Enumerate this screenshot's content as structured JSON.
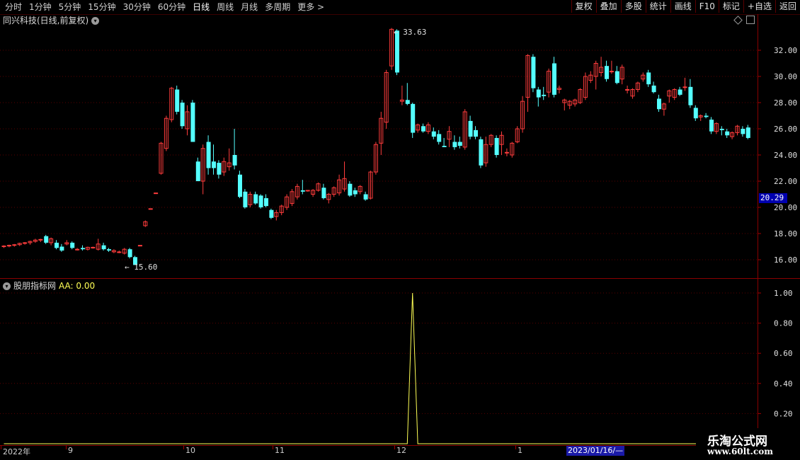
{
  "toolbar": {
    "periods": [
      "分时",
      "1分钟",
      "5分钟",
      "15分钟",
      "30分钟",
      "60分钟",
      "日线",
      "周线",
      "月线",
      "多周期",
      "更多 >"
    ],
    "active_period": "日线",
    "buttons": [
      "复权",
      "叠加",
      "多股",
      "统计",
      "画线",
      "F10",
      "标记",
      "+自选",
      "返回"
    ]
  },
  "main_panel": {
    "title": "同兴科技(日线,前复权)",
    "price_axis_labels": [
      "32.00",
      "30.00",
      "28.00",
      "26.00",
      "24.00",
      "22.00",
      "20.00",
      "18.00",
      "16.00"
    ],
    "current_price_flag": "20.29",
    "high_annotation": "33.63",
    "low_annotation": "15.60"
  },
  "indicator_panel": {
    "name": "股朋指标网",
    "series_label": "AA: 0.00",
    "axis_labels": [
      "1.00",
      "0.80",
      "0.60",
      "0.40",
      "0.20"
    ]
  },
  "date_axis": {
    "labels": [
      "2022年",
      "9",
      "10",
      "11",
      "12",
      "1"
    ],
    "cursor_date": "2023/01/16/—"
  },
  "watermark": {
    "line1": "乐淘公式网",
    "line2": "www.60lt.com"
  },
  "colors": {
    "up_candle": "#ff3c3c",
    "down_candle": "#54ffff",
    "indicator_line": "#ffff55",
    "grid": "#5a0000",
    "flag_bg": "#0000b0"
  },
  "chart_data": {
    "type": "candlestick",
    "y_range": [
      15,
      34
    ],
    "candles": [
      [
        17.0,
        17.05,
        16.95,
        17.1,
        16.9
      ],
      [
        17.05,
        17.1,
        17.0,
        17.15,
        16.95
      ],
      [
        17.1,
        17.15,
        17.05,
        17.2,
        17.0
      ],
      [
        17.15,
        17.25,
        17.1,
        17.3,
        17.05
      ],
      [
        17.25,
        17.3,
        17.2,
        17.35,
        17.15
      ],
      [
        17.3,
        17.4,
        17.2,
        17.45,
        17.15
      ],
      [
        17.4,
        17.5,
        17.35,
        17.6,
        17.3
      ],
      [
        17.5,
        17.55,
        17.4,
        17.6,
        17.35
      ],
      [
        17.8,
        17.3,
        17.9,
        17.9,
        17.2
      ],
      [
        17.3,
        17.6,
        17.2,
        17.7,
        17.1
      ],
      [
        17.3,
        16.9,
        17.4,
        17.5,
        16.8
      ],
      [
        17.0,
        16.7,
        17.1,
        17.2,
        16.6
      ],
      [
        17.2,
        17.3,
        17.4,
        17.5,
        17.1
      ],
      [
        17.3,
        16.9,
        17.4,
        17.4,
        16.8
      ],
      [
        16.8,
        16.8,
        16.9,
        16.9,
        16.7
      ],
      [
        16.9,
        16.8,
        17.0,
        17.1,
        16.7
      ],
      [
        16.8,
        16.95,
        16.75,
        17.0,
        16.7
      ],
      [
        16.9,
        16.95,
        16.85,
        17.0,
        16.85
      ],
      [
        16.8,
        17.2,
        16.7,
        17.6,
        16.7
      ],
      [
        17.1,
        16.8,
        17.2,
        17.3,
        16.7
      ],
      [
        16.8,
        16.7,
        16.85,
        16.9,
        16.6
      ],
      [
        16.6,
        16.7,
        16.55,
        16.8,
        16.5
      ],
      [
        16.6,
        16.6,
        16.55,
        16.7,
        16.5
      ],
      [
        16.5,
        16.8,
        16.45,
        16.9,
        16.4
      ],
      [
        16.8,
        16.2,
        16.85,
        16.9,
        16.1
      ],
      [
        16.2,
        15.6,
        16.3,
        16.3,
        15.6
      ],
      [
        17.1,
        17.1,
        17.1,
        17.1,
        17.1
      ],
      [
        18.6,
        18.9,
        18.5,
        19.0,
        18.5
      ],
      [
        19.9,
        19.9,
        19.9,
        19.9,
        19.9
      ],
      [
        21.1,
        21.1,
        21.1,
        21.1,
        21.1
      ],
      [
        22.6,
        24.9,
        22.5,
        25.0,
        22.5
      ],
      [
        24.5,
        26.8,
        24.4,
        27.0,
        24.3
      ],
      [
        26.7,
        29.1,
        26.6,
        29.2,
        26.5
      ],
      [
        29.0,
        27.3,
        29.2,
        29.3,
        27.1
      ],
      [
        28.0,
        26.2,
        28.1,
        28.2,
        26.0
      ],
      [
        26.0,
        27.3,
        25.5,
        27.8,
        25.5
      ],
      [
        28.0,
        25.0,
        28.2,
        28.2,
        25.0
      ],
      [
        23.5,
        22.0,
        23.6,
        23.8,
        22.0
      ],
      [
        22.0,
        24.5,
        21.8,
        24.8,
        21.0
      ],
      [
        25.0,
        23.0,
        25.2,
        25.5,
        22.5
      ],
      [
        23.5,
        23.0,
        24.8,
        24.8,
        22.5
      ],
      [
        23.4,
        22.5,
        23.5,
        23.6,
        22.2
      ],
      [
        22.7,
        23.5,
        22.6,
        23.8,
        22.4
      ],
      [
        23.1,
        23.4,
        23.0,
        24.5,
        22.8
      ],
      [
        24.0,
        23.2,
        24.1,
        26.0,
        22.9
      ],
      [
        22.5,
        20.8,
        22.6,
        22.8,
        20.7
      ],
      [
        21.2,
        20.0,
        21.3,
        21.4,
        19.9
      ],
      [
        20.2,
        21.0,
        20.1,
        21.2,
        20.0
      ],
      [
        21.0,
        20.3,
        21.1,
        21.2,
        20.2
      ],
      [
        20.9,
        20.0,
        21.0,
        21.0,
        19.9
      ],
      [
        20.7,
        20.1,
        20.9,
        21.0,
        20.0
      ],
      [
        19.8,
        19.2,
        19.9,
        19.9,
        19.1
      ],
      [
        19.3,
        19.6,
        19.0,
        19.8,
        19.0
      ],
      [
        19.6,
        20.1,
        19.5,
        20.2,
        19.4
      ],
      [
        20.0,
        20.8,
        19.9,
        21.0,
        19.8
      ],
      [
        20.3,
        21.2,
        20.2,
        21.4,
        20.1
      ],
      [
        20.8,
        21.6,
        20.7,
        21.8,
        20.6
      ],
      [
        21.3,
        21.2,
        21.4,
        22.1,
        21.0
      ],
      [
        21.3,
        21.3,
        21.3,
        21.3,
        21.2
      ],
      [
        21.0,
        21.3,
        20.9,
        21.4,
        20.8
      ],
      [
        21.3,
        21.8,
        21.2,
        21.9,
        21.2
      ],
      [
        21.5,
        20.7,
        21.6,
        21.8,
        20.6
      ],
      [
        20.6,
        21.0,
        20.5,
        21.1,
        20.3
      ],
      [
        21.0,
        21.5,
        20.9,
        21.6,
        20.8
      ],
      [
        21.1,
        22.1,
        21.0,
        22.5,
        20.9
      ],
      [
        21.4,
        22.2,
        21.3,
        23.5,
        21.2
      ],
      [
        21.8,
        20.9,
        21.9,
        22.0,
        20.8
      ],
      [
        21.3,
        21.0,
        21.4,
        21.5,
        20.8
      ],
      [
        21.2,
        21.6,
        21.1,
        21.7,
        21.0
      ],
      [
        21.0,
        20.6,
        21.1,
        21.2,
        20.5
      ],
      [
        20.7,
        22.7,
        20.6,
        22.8,
        20.6
      ],
      [
        22.7,
        24.8,
        22.6,
        25.0,
        22.5
      ],
      [
        24.9,
        26.8,
        24.8,
        27.3,
        24.0
      ],
      [
        26.5,
        30.3,
        26.4,
        30.5,
        26.0
      ],
      [
        30.8,
        33.6,
        30.5,
        33.7,
        30.5
      ],
      [
        33.5,
        30.3,
        33.6,
        33.6,
        30.1
      ],
      [
        28.1,
        28.2,
        28.0,
        29.3,
        27.8
      ],
      [
        28.2,
        27.9,
        28.3,
        29.5,
        27.8
      ],
      [
        27.9,
        25.7,
        28.0,
        28.0,
        25.3
      ],
      [
        25.9,
        26.3,
        25.8,
        26.4,
        25.7
      ],
      [
        26.2,
        25.8,
        26.3,
        26.4,
        25.7
      ],
      [
        25.8,
        26.3,
        25.6,
        26.5,
        25.6
      ],
      [
        25.8,
        25.4,
        26.0,
        26.1,
        25.2
      ],
      [
        25.6,
        25.0,
        25.8,
        25.9,
        24.8
      ],
      [
        24.7,
        24.6,
        24.8,
        25.3,
        24.6
      ],
      [
        25.2,
        25.8,
        24.8,
        26.2,
        24.6
      ],
      [
        25.0,
        24.6,
        25.4,
        25.5,
        24.4
      ],
      [
        25.0,
        24.7,
        25.2,
        25.4,
        24.5
      ],
      [
        24.6,
        27.3,
        24.5,
        27.5,
        24.4
      ],
      [
        26.6,
        25.4,
        26.8,
        27.0,
        25.2
      ],
      [
        25.9,
        25.4,
        26.0,
        26.2,
        25.2
      ],
      [
        25.2,
        23.2,
        25.3,
        25.4,
        23.0
      ],
      [
        23.4,
        24.8,
        23.2,
        25.4,
        23.1
      ],
      [
        24.8,
        25.5,
        24.7,
        25.6,
        24.6
      ],
      [
        25.3,
        24.0,
        25.4,
        25.5,
        23.8
      ],
      [
        24.8,
        25.5,
        24.3,
        25.8,
        24.0
      ],
      [
        24.2,
        24.2,
        24.1,
        24.5,
        23.9
      ],
      [
        24.0,
        24.9,
        23.8,
        25.0,
        23.8
      ],
      [
        25.0,
        26.0,
        24.9,
        26.2,
        24.9
      ],
      [
        26.0,
        28.1,
        25.9,
        28.5,
        25.7
      ],
      [
        28.4,
        31.6,
        28.0,
        31.7,
        27.3
      ],
      [
        31.5,
        29.1,
        31.7,
        31.7,
        28.8
      ],
      [
        29.0,
        28.4,
        29.1,
        29.2,
        27.7
      ],
      [
        28.6,
        28.5,
        28.7,
        29.2,
        28.2
      ],
      [
        28.8,
        30.4,
        28.5,
        30.6,
        28.4
      ],
      [
        31.0,
        28.6,
        31.5,
        31.5,
        28.4
      ],
      [
        29.0,
        29.1,
        28.8,
        29.3,
        28.7
      ],
      [
        28.0,
        28.2,
        27.6,
        28.3,
        27.4
      ],
      [
        27.8,
        28.1,
        27.7,
        28.2,
        27.5
      ],
      [
        27.9,
        28.2,
        27.8,
        28.3,
        27.7
      ],
      [
        28.0,
        29.0,
        27.9,
        29.1,
        27.9
      ],
      [
        28.4,
        30.0,
        28.3,
        30.3,
        28.2
      ],
      [
        29.7,
        30.1,
        29.6,
        30.4,
        29.5
      ],
      [
        30.0,
        31.0,
        29.9,
        31.2,
        29.0
      ],
      [
        30.3,
        30.7,
        30.2,
        31.5,
        30.0
      ],
      [
        30.8,
        29.8,
        30.9,
        31.2,
        29.6
      ],
      [
        30.4,
        30.4,
        30.3,
        31.2,
        30.2
      ],
      [
        30.4,
        29.5,
        30.5,
        30.8,
        29.4
      ],
      [
        29.8,
        30.7,
        29.6,
        30.9,
        29.4
      ],
      [
        29.0,
        29.0,
        28.9,
        29.3,
        28.7
      ],
      [
        28.5,
        29.0,
        28.4,
        29.1,
        28.3
      ],
      [
        29.0,
        29.5,
        28.9,
        29.6,
        28.8
      ],
      [
        29.8,
        30.1,
        29.7,
        30.3,
        29.6
      ],
      [
        30.3,
        29.4,
        30.4,
        30.5,
        29.2
      ],
      [
        29.3,
        28.8,
        29.4,
        29.6,
        28.7
      ],
      [
        28.3,
        27.5,
        28.4,
        28.6,
        27.3
      ],
      [
        27.5,
        27.9,
        27.2,
        28.0,
        27.0
      ],
      [
        28.5,
        28.9,
        28.4,
        29.0,
        28.0
      ],
      [
        28.4,
        29.0,
        28.3,
        29.1,
        28.2
      ],
      [
        29.0,
        28.6,
        29.1,
        29.2,
        28.5
      ],
      [
        29.2,
        29.2,
        29.1,
        29.9,
        28.9
      ],
      [
        29.2,
        27.8,
        29.3,
        29.8,
        27.6
      ],
      [
        27.6,
        26.8,
        27.7,
        27.8,
        26.6
      ],
      [
        26.9,
        27.0,
        26.8,
        27.1,
        26.6
      ],
      [
        27.0,
        26.9,
        27.0,
        27.2,
        26.8
      ],
      [
        26.7,
        25.8,
        26.8,
        26.9,
        25.6
      ],
      [
        25.8,
        26.4,
        25.7,
        26.5,
        25.6
      ],
      [
        26.0,
        25.9,
        26.1,
        26.2,
        25.5
      ],
      [
        25.8,
        25.5,
        25.9,
        26.0,
        25.3
      ],
      [
        25.4,
        25.7,
        25.3,
        25.8,
        25.2
      ],
      [
        25.7,
        26.2,
        25.6,
        26.3,
        25.5
      ],
      [
        26.0,
        25.6,
        26.1,
        26.2,
        25.4
      ],
      [
        26.1,
        25.3,
        26.2,
        26.3,
        25.2
      ]
    ]
  }
}
